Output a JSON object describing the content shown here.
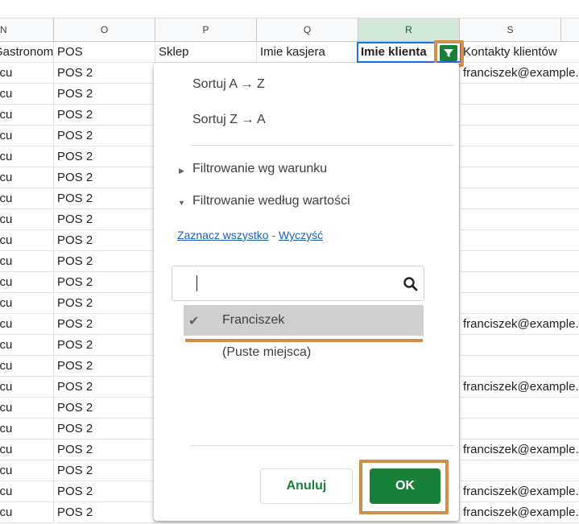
{
  "columns": [
    {
      "letter": "N",
      "selected": false
    },
    {
      "letter": "O",
      "selected": false
    },
    {
      "letter": "P",
      "selected": false
    },
    {
      "letter": "Q",
      "selected": false
    },
    {
      "letter": "R",
      "selected": true
    },
    {
      "letter": "S",
      "selected": false
    }
  ],
  "header_row": {
    "n": "Gastronomia",
    "o": "POS",
    "p": "Sklep",
    "q": "Imie kasjera",
    "r": "Imie klienta",
    "s": "Kontakty klientów"
  },
  "rows": [
    {
      "n": "scu",
      "o": "POS 2",
      "s": "franciszek@example.com"
    },
    {
      "n": "scu",
      "o": "POS 2",
      "s": ""
    },
    {
      "n": "scu",
      "o": "POS 2",
      "s": ""
    },
    {
      "n": "scu",
      "o": "POS 2",
      "s": ""
    },
    {
      "n": "scu",
      "o": "POS 2",
      "s": ""
    },
    {
      "n": "scu",
      "o": "POS 2",
      "s": ""
    },
    {
      "n": "scu",
      "o": "POS 2",
      "s": ""
    },
    {
      "n": "scu",
      "o": "POS 2",
      "s": ""
    },
    {
      "n": "scu",
      "o": "POS 2",
      "s": ""
    },
    {
      "n": "scu",
      "o": "POS 2",
      "s": ""
    },
    {
      "n": "scu",
      "o": "POS 2",
      "s": ""
    },
    {
      "n": "scu",
      "o": "POS 2",
      "s": ""
    },
    {
      "n": "scu",
      "o": "POS 2",
      "s": "franciszek@example.com"
    },
    {
      "n": "scu",
      "o": "POS 2",
      "s": ""
    },
    {
      "n": "scu",
      "o": "POS 2",
      "s": ""
    },
    {
      "n": "scu",
      "o": "POS 2",
      "s": "franciszek@example.com"
    },
    {
      "n": "scu",
      "o": "POS 2",
      "s": ""
    },
    {
      "n": "scu",
      "o": "POS 2",
      "s": ""
    },
    {
      "n": "scu",
      "o": "POS 2",
      "s": "franciszek@example.com"
    },
    {
      "n": "scu",
      "o": "POS 2",
      "s": ""
    },
    {
      "n": "scu",
      "o": "POS 2",
      "s": "franciszek@example.com"
    },
    {
      "n": "scu",
      "o": "POS 2",
      "s": "franciszek@example.com"
    }
  ],
  "menu": {
    "sort_az": "Sortuj A → Z",
    "sort_za": "Sortuj Z → A",
    "filter_condition": "Filtrowanie wg warunku",
    "filter_values": "Filtrowanie według wartości",
    "select_all": "Zaznacz wszystko",
    "link_separator": " - ",
    "clear": "Wyczyść",
    "search_value": "",
    "options": [
      {
        "label": "Franciszek",
        "checked": true
      },
      {
        "label": "(Puste miejsca)",
        "checked": false
      }
    ],
    "cancel_label": "Anuluj",
    "ok_label": "OK"
  },
  "colors": {
    "accent_green": "#188038",
    "highlight_orange": "#d08e4b",
    "selected_col_header": "#d3e8d9",
    "active_cell_border": "#1a73e8"
  },
  "icons": {
    "filter": "funnel-icon",
    "search": "magnifier-icon",
    "check": "checkmark-icon",
    "expand_right": "triangle-right-icon",
    "expand_down": "triangle-down-icon"
  }
}
